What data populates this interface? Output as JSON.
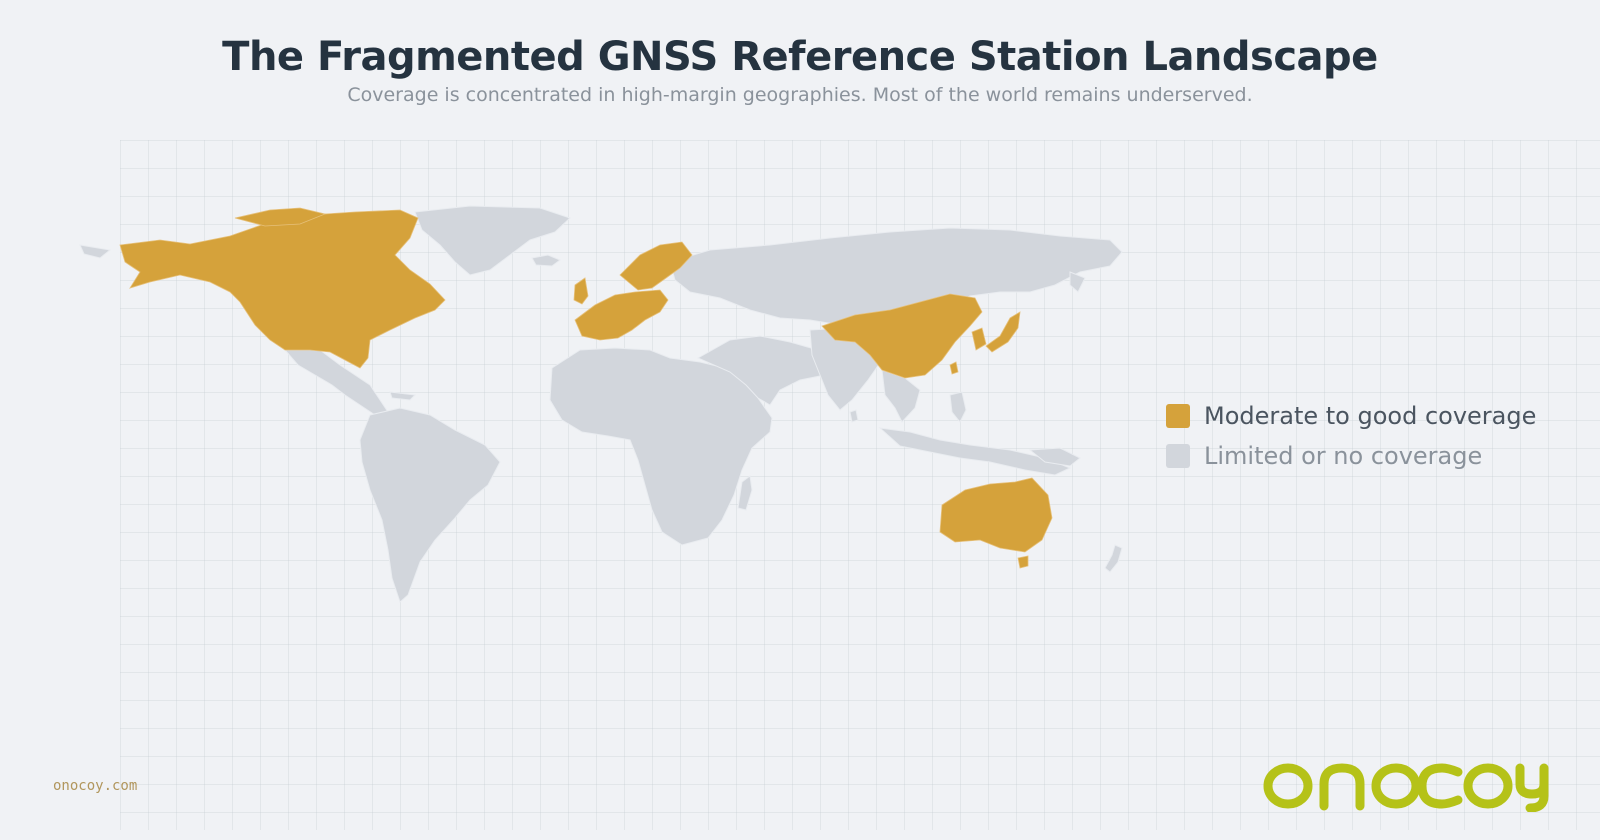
{
  "header": {
    "title": "The Fragmented GNSS Reference Station Landscape",
    "subtitle": "Coverage is concentrated in high-margin geographies. Most of the world remains underserved."
  },
  "map": {
    "colors": {
      "covered": "#d5a23b",
      "uncovered": "#d2d6dc",
      "background": "#f0f2f5"
    },
    "covered_regions": [
      "North America",
      "Western Europe",
      "Scandinavia",
      "China",
      "Japan",
      "South Korea",
      "Australia"
    ],
    "uncovered_regions": [
      "Greenland",
      "Mexico & Central America",
      "South America",
      "Africa",
      "Middle East",
      "Russia & Central Asia",
      "India",
      "Southeast Asia",
      "New Zealand"
    ]
  },
  "legend": {
    "items": [
      {
        "label": "Moderate to good coverage",
        "color": "#d5a23b",
        "text_color": "#4b5560"
      },
      {
        "label": "Limited or no coverage",
        "color": "#d2d6dc",
        "text_color": "#8a929b"
      }
    ]
  },
  "footer": {
    "url": "onocoy.com",
    "logo_text": "onocoy",
    "logo_color": "#b5c218"
  }
}
